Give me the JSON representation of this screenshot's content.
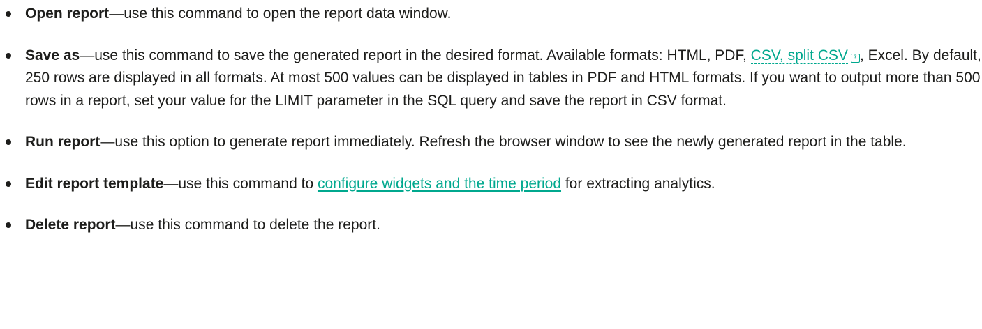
{
  "items": [
    {
      "term": "Open report",
      "text": "—use this command to open the report data window."
    },
    {
      "term": "Save as",
      "text_before": "—use this command to save the generated report in the desired format. Available formats: HTML, PDF, ",
      "link": "CSV, split CSV",
      "help_icon": "?",
      "text_after": ", Excel. By default, 250 rows are displayed in all formats. At most 500 values can be displayed in tables in PDF and HTML formats. If you want to output more than 500 rows in a report, set your value for the LIMIT parameter in the SQL query and save the report in CSV format."
    },
    {
      "term": "Run report",
      "text": "—use this option to generate report immediately. Refresh the browser window to see the newly generated report in the table."
    },
    {
      "term": "Edit report template",
      "text_before": "—use this command to ",
      "link": "configure widgets and the time period",
      "text_after": " for extracting analytics."
    },
    {
      "term": "Delete report",
      "text": "—use this command to delete the report."
    }
  ],
  "colors": {
    "text": "#1d1d1b",
    "link": "#00a88e"
  }
}
